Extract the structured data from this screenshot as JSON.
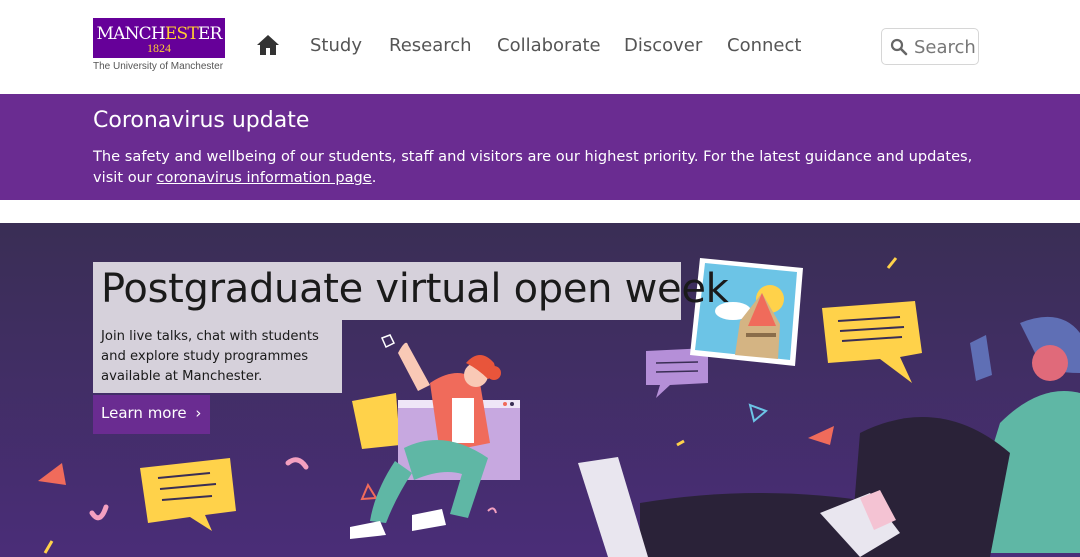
{
  "logo": {
    "word_start": "MANCH",
    "word_gold": "EST",
    "word_end": "ER",
    "year": "1824",
    "subtitle": "The University of Manchester"
  },
  "nav": {
    "items": [
      {
        "label": "Study"
      },
      {
        "label": "Research"
      },
      {
        "label": "Collaborate"
      },
      {
        "label": "Discover"
      },
      {
        "label": "Connect"
      }
    ]
  },
  "search": {
    "label": "Search"
  },
  "covid": {
    "title": "Coronavirus update",
    "text_before": "The safety and wellbeing of our students, staff and visitors are our highest priority. For the latest guidance and updates, visit our ",
    "link_text": "coronavirus information page",
    "text_after": "."
  },
  "hero": {
    "title": "Postgraduate virtual open week",
    "description": "Join live talks, chat with students and explore study programmes available at Manchester.",
    "button_label": "Learn more",
    "button_chevron": "›"
  },
  "colors": {
    "brand_purple": "#660099",
    "banner_purple": "#6a2c91",
    "hero_bg": "#3d2d5d",
    "gold": "#ffcc33"
  },
  "icons": {
    "home": "home-icon",
    "search": "search-icon"
  }
}
